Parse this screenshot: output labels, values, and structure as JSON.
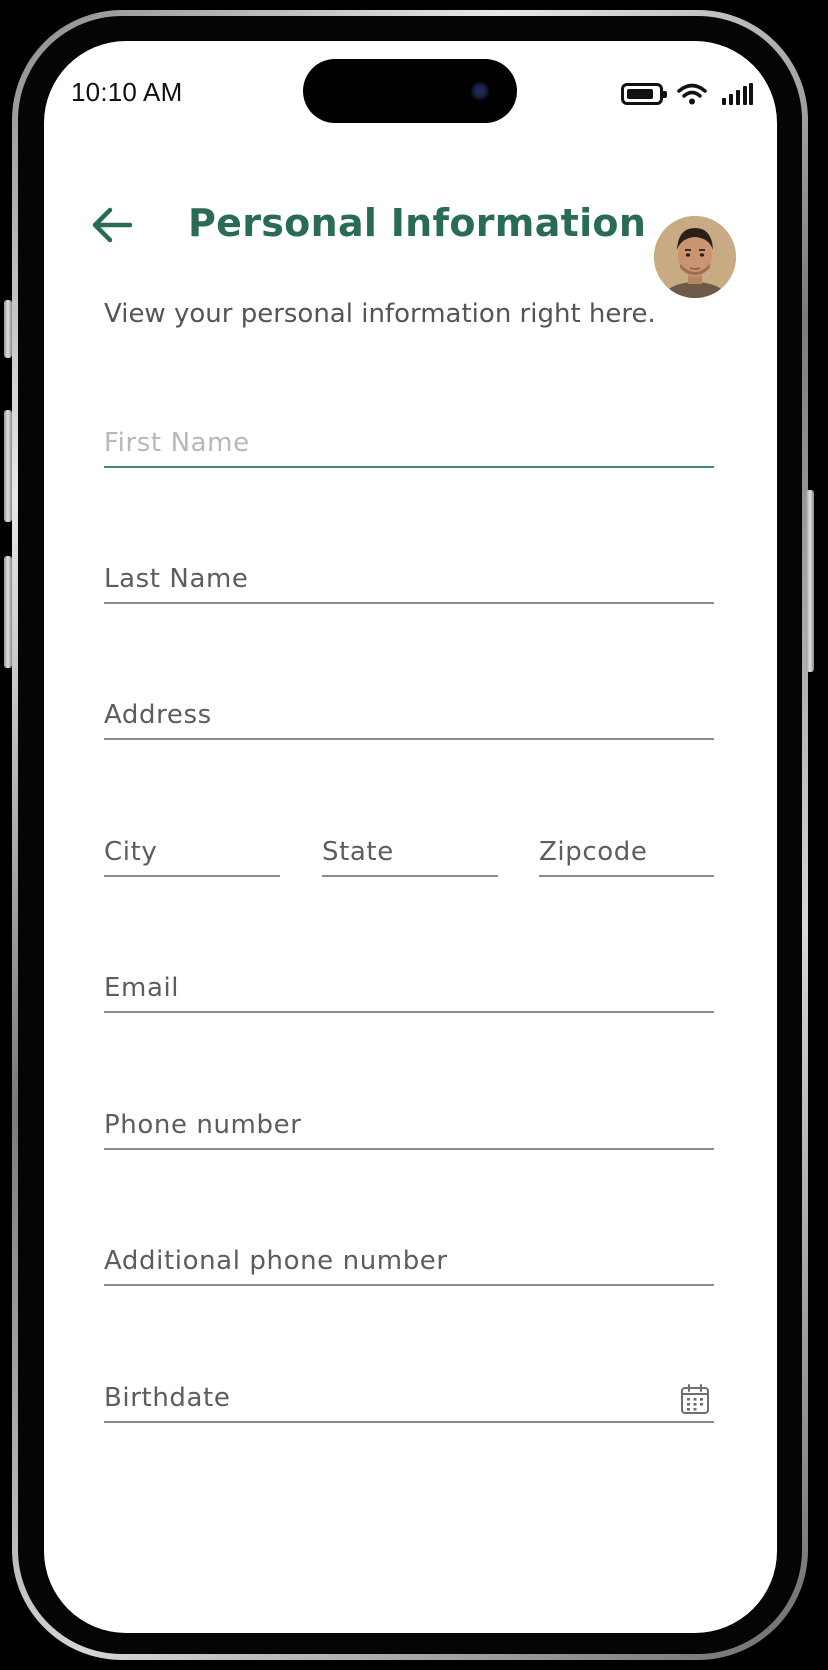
{
  "status_bar": {
    "time": "10:10 AM",
    "icons": [
      "battery-icon",
      "wifi-icon",
      "signal-icon"
    ]
  },
  "header": {
    "title": "Personal Information",
    "back_icon": "arrow-left-icon",
    "avatar": "user-avatar-photo"
  },
  "subtitle": "View your personal information right here.",
  "form": {
    "first_name": {
      "placeholder": "First Name",
      "value": ""
    },
    "last_name": {
      "placeholder": "Last Name",
      "value": ""
    },
    "address": {
      "placeholder": "Address",
      "value": ""
    },
    "city": {
      "placeholder": "City",
      "value": ""
    },
    "state": {
      "placeholder": "State",
      "value": ""
    },
    "zipcode": {
      "placeholder": "Zipcode",
      "value": ""
    },
    "email": {
      "placeholder": "Email",
      "value": ""
    },
    "phone": {
      "placeholder": "Phone number",
      "value": ""
    },
    "additional_phone": {
      "placeholder": "Additional phone number",
      "value": ""
    },
    "birthdate": {
      "placeholder": "Birthdate",
      "value": "",
      "icon": "calendar-icon"
    }
  },
  "colors": {
    "accent": "#2a6b55",
    "focus_underline": "#3c8c73",
    "underline": "#8a8a8a",
    "text": "#555555"
  }
}
